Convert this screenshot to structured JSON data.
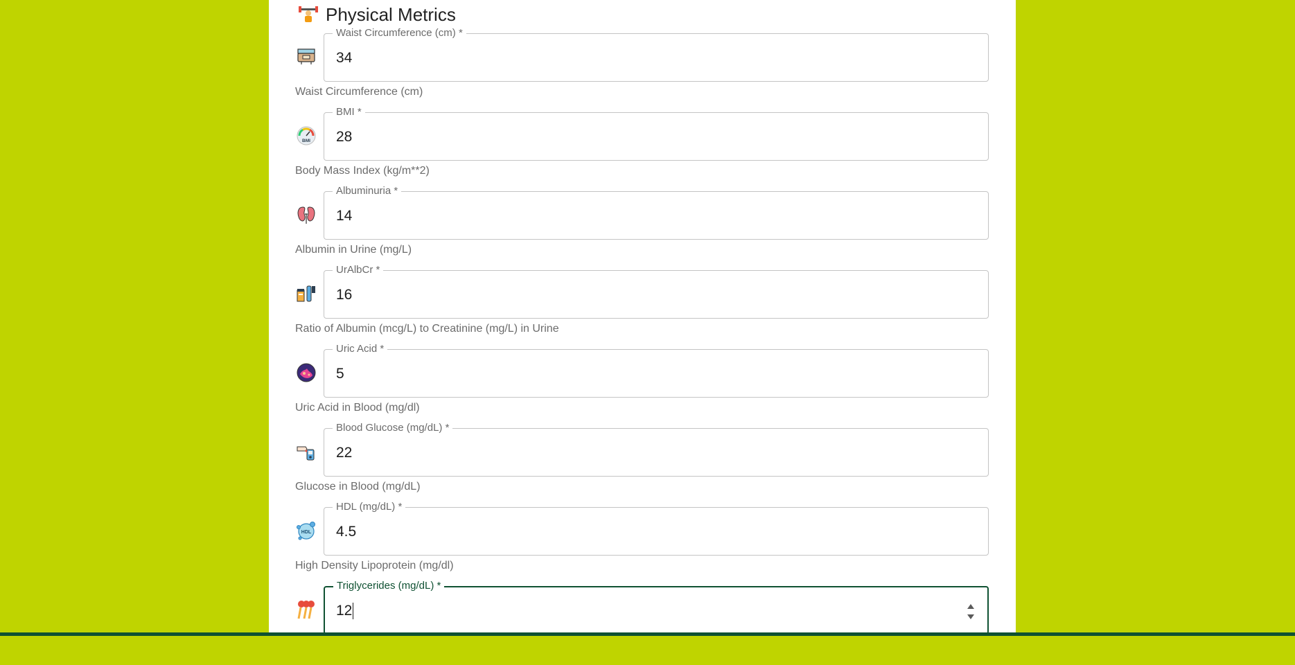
{
  "section": {
    "title": "Physical Metrics",
    "icon": "fitness-icon"
  },
  "fields": [
    {
      "label": "Waist Circumference (cm) *",
      "value": "34",
      "helper": "Waist Circumference (cm)",
      "icon": "measuring-tape-icon"
    },
    {
      "label": "BMI *",
      "value": "28",
      "helper": "Body Mass Index (kg/m**2)",
      "icon": "bmi-gauge-icon",
      "icon_text": "BMI"
    },
    {
      "label": "Albuminuria *",
      "value": "14",
      "helper": "Albumin in Urine (mg/L)",
      "icon": "kidney-icon"
    },
    {
      "label": "UrAlbCr *",
      "value": "16",
      "helper": "Ratio of Albumin (mcg/L) to Creatinine (mg/L) in Urine",
      "icon": "urine-test-icon"
    },
    {
      "label": "Uric Acid *",
      "value": "5",
      "helper": "Uric Acid in Blood (mg/dl)",
      "icon": "uric-acid-icon"
    },
    {
      "label": "Blood Glucose (mg/dL) *",
      "value": "22",
      "helper": "Glucose in Blood (mg/dL)",
      "icon": "glucose-meter-icon"
    },
    {
      "label": "HDL (mg/dL) *",
      "value": "4.5",
      "helper": "High Density Lipoprotein (mg/dl)",
      "icon": "hdl-molecule-icon",
      "icon_text": "HDL"
    },
    {
      "label": "Triglycerides (mg/dL) *",
      "value": "12",
      "icon": "triglycerides-icon"
    }
  ],
  "colors": {
    "background": "#bfd400",
    "card": "#ffffff",
    "focus": "#0f5132"
  }
}
